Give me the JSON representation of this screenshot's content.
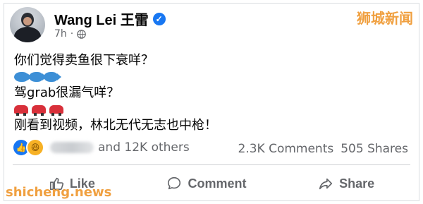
{
  "post": {
    "author": "Wang Lei 王雷",
    "time": "7h",
    "lines": [
      "你们觉得卖鱼很下衰咩？",
      "驾grab很漏气咩？",
      "刚看到视频，林北无代无志也中枪！"
    ]
  },
  "engagement": {
    "reactions_text": "and 12K others",
    "comments": "2.3K Comments",
    "shares": "505 Shares"
  },
  "actions": {
    "like": "Like",
    "comment": "Comment",
    "share": "Share"
  },
  "watermarks": {
    "top": "狮城新闻",
    "bottom": "shicheng.news"
  },
  "icons": {
    "verified": "verified-badge-icon",
    "globe": "globe-icon",
    "fish": "fish-emoji-icon",
    "car": "car-emoji-icon",
    "like_reaction": "like-reaction-icon",
    "haha_reaction": "haha-reaction-icon"
  },
  "colors": {
    "accent": "#1877f2",
    "muted_text": "#65676b",
    "watermark": "#f0a040"
  }
}
